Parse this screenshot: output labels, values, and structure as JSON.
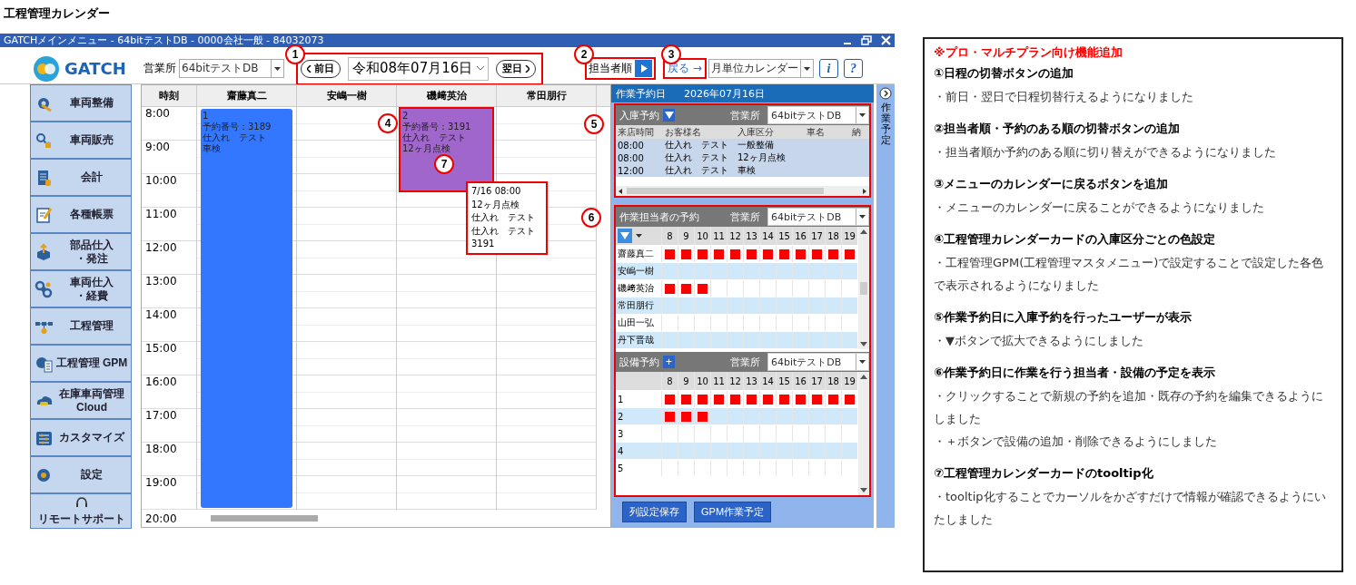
{
  "page_title": "工程管理カレンダー",
  "window": {
    "title": "GATCHメインメニュー - 64bitテストDB - 0000会社一般 - 84032073"
  },
  "toolbar": {
    "logo": "GATCH",
    "office_label": "営業所",
    "office_value": "64bitテストDB",
    "prev_button": "前日",
    "date": "令和08年07月16日",
    "next_button": "翌日",
    "order_button": "担当者順",
    "back_link": "戻る →",
    "view_select": "月単位カレンダー",
    "info_button": "i",
    "help_button": "?"
  },
  "sidebar": [
    {
      "lines": [
        "車両整備"
      ]
    },
    {
      "lines": [
        "車両販売"
      ]
    },
    {
      "lines": [
        "会計"
      ]
    },
    {
      "lines": [
        "各種帳票"
      ]
    },
    {
      "lines": [
        "部品仕入",
        "・発注"
      ]
    },
    {
      "lines": [
        "車両仕入",
        "・経費"
      ]
    },
    {
      "lines": [
        "工程管理"
      ]
    },
    {
      "lines": [
        "工程管理 GPM"
      ]
    },
    {
      "lines": [
        "在庫車両管理",
        "Cloud"
      ]
    },
    {
      "lines": [
        "カスタマイズ"
      ]
    },
    {
      "lines": [
        "設定"
      ]
    },
    {
      "lines": [
        "リモートサポート"
      ]
    }
  ],
  "calendar": {
    "time_header": "時刻",
    "hours": [
      "8:00",
      "9:00",
      "10:00",
      "11:00",
      "12:00",
      "13:00",
      "14:00",
      "15:00",
      "16:00",
      "17:00",
      "18:00",
      "19:00",
      "20:00"
    ],
    "columns": [
      {
        "name": "齋藤真二",
        "cards": [
          {
            "level": 1,
            "color": "#3377ff",
            "highlighted": false,
            "lines": [
              "1",
              "予約番号：3189",
              "仕入れ　テスト",
              "車検"
            ]
          }
        ]
      },
      {
        "name": "安嶋一樹"
      },
      {
        "name": "磯﨑英治",
        "cards": [
          {
            "level": 0.21,
            "color": "#a066cc",
            "highlighted": true,
            "lines": [
              "2",
              "予約番号：3191",
              "仕入れ　テスト",
              "12ヶ月点検"
            ]
          }
        ]
      },
      {
        "name": "常田朋行"
      }
    ],
    "tooltip": {
      "lines": [
        "7/16 08:00",
        "12ヶ月点検",
        "仕入れ　テスト",
        "仕入れ　テスト",
        "3191"
      ]
    }
  },
  "panel": {
    "header_label": "作業予約日",
    "header_date": "2026年07月16日",
    "side_tab": "作業予定",
    "reception": {
      "title": "入庫予約",
      "office_label": "営業所",
      "office_value": "64bitテストDB",
      "columns": [
        "来店時間",
        "お客様名",
        "入庫区分",
        "車名",
        "納"
      ],
      "rows": [
        [
          "08:00",
          "仕入れ　テスト",
          "一般整備"
        ],
        [
          "08:00",
          "仕入れ　テスト",
          "12ヶ月点検"
        ],
        [
          "12:00",
          "仕入れ　テスト",
          "車検"
        ]
      ]
    },
    "staff_schedule": {
      "title": "作業担当者の予約",
      "office_label": "営業所",
      "office_value": "64bitテストDB",
      "hours": [
        "8",
        "9",
        "10",
        "11",
        "12",
        "13",
        "14",
        "15",
        "16",
        "17",
        "18",
        "19"
      ],
      "rows": [
        {
          "name": "齋藤真二",
          "booked": [
            true,
            true,
            true,
            true,
            true,
            true,
            true,
            true,
            true,
            true,
            true,
            true
          ]
        },
        {
          "name": "安嶋一樹",
          "booked": [
            false,
            false,
            false,
            false,
            false,
            false,
            false,
            false,
            false,
            false,
            false,
            false
          ]
        },
        {
          "name": "磯﨑英治",
          "booked": [
            true,
            true,
            true,
            false,
            false,
            false,
            false,
            false,
            false,
            false,
            false,
            false
          ]
        },
        {
          "name": "常田朋行",
          "booked": [
            false,
            false,
            false,
            false,
            false,
            false,
            false,
            false,
            false,
            false,
            false,
            false
          ]
        },
        {
          "name": "山田一弘",
          "booked": [
            false,
            false,
            false,
            false,
            false,
            false,
            false,
            false,
            false,
            false,
            false,
            false
          ]
        },
        {
          "name": "丹下晋哉",
          "booked": [
            false,
            false,
            false,
            false,
            false,
            false,
            false,
            false,
            false,
            false,
            false,
            false
          ]
        }
      ]
    },
    "equipment": {
      "title": "設備予約",
      "add_button": "+",
      "office_label": "営業所",
      "office_value": "64bitテストDB",
      "hours": [
        "8",
        "9",
        "10",
        "11",
        "12",
        "13",
        "14",
        "15",
        "16",
        "17",
        "18",
        "19"
      ],
      "rows": [
        {
          "name": "1",
          "booked": [
            true,
            true,
            true,
            true,
            true,
            true,
            true,
            true,
            true,
            true,
            true,
            true
          ]
        },
        {
          "name": "2",
          "booked": [
            true,
            true,
            true,
            false,
            false,
            false,
            false,
            false,
            false,
            false,
            false,
            false
          ]
        },
        {
          "name": "3",
          "booked": [
            false,
            false,
            false,
            false,
            false,
            false,
            false,
            false,
            false,
            false,
            false,
            false
          ]
        },
        {
          "name": "4",
          "booked": [
            false,
            false,
            false,
            false,
            false,
            false,
            false,
            false,
            false,
            false,
            false,
            false
          ]
        },
        {
          "name": "5",
          "booked": [
            false,
            false,
            false,
            false,
            false,
            false,
            false,
            false,
            false,
            false,
            false,
            false
          ]
        }
      ]
    },
    "buttons": [
      "列設定保存",
      "GPM作業予定"
    ]
  },
  "annotations": [
    {
      "number": "1"
    },
    {
      "number": "2"
    },
    {
      "number": "3"
    },
    {
      "number": "4"
    },
    {
      "number": "5"
    },
    {
      "number": "6"
    },
    {
      "number": "7"
    }
  ],
  "notes": {
    "heading": "※プロ・マルチプラン向け機能追加",
    "items": [
      {
        "title": "①日程の切替ボタンの追加",
        "lines": [
          "・前日・翌日で日程切替行えるようになりました"
        ]
      },
      {
        "title": "②担当者順・予約のある順の切替ボタンの追加",
        "lines": [
          "・担当者順か予約のある順に切り替えができるようになりました"
        ]
      },
      {
        "title": "③メニューのカレンダーに戻るボタンを追加",
        "lines": [
          "・メニューのカレンダーに戻ることができるようになりました"
        ]
      },
      {
        "title": "④工程管理カレンダーカードの入庫区分ごとの色設定",
        "lines": [
          "・工程管理GPM(工程管理マスタメニュー)で設定することで設定した各色で表示されるようになりました"
        ]
      },
      {
        "title": "⑤作業予約日に入庫予約を行ったユーザーが表示",
        "lines": [
          "・▼ボタンで拡大できるようにしました"
        ]
      },
      {
        "title": "⑥作業予約日に作業を行う担当者・設備の予定を表示",
        "lines": [
          "・クリックすることで新規の予約を追加・既存の予約を編集できるようにしました",
          "・＋ボタンで設備の追加・削除できるようにしました"
        ]
      },
      {
        "title": "⑦工程管理カレンダーカードのtooltip化",
        "lines": [
          "・tooltip化することでカーソルをかざすだけで情報が確認できるようにいたしました"
        ]
      }
    ]
  }
}
